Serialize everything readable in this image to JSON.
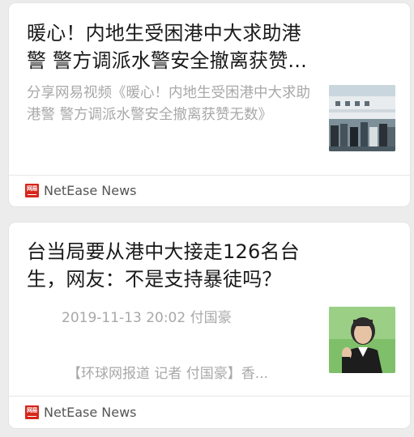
{
  "articles": [
    {
      "title_line1": "暖心！内地生受困港中大求助港",
      "title_line2": "警 警方调派水警安全撤离获赞...",
      "summary": "分享网易视频《暖心！内地生受困港中大求助港警 警方调派水警安全撤离获赞无数》",
      "thumbnail": "image-boat-rescue",
      "source_logo": "网易",
      "source_name": "NetEase News"
    },
    {
      "title_line1": "台当局要从港中大接走126名台",
      "title_line2": "生，网友：不是支持暴徒吗？",
      "meta": "2019-11-13 20:02 付国豪",
      "excerpt": "【环球网报道 记者 付国豪】香...",
      "thumbnail": "image-official-portrait",
      "source_logo": "网易",
      "source_name": "NetEase News"
    }
  ],
  "colors": {
    "background": "#ececec",
    "card": "#ffffff",
    "title": "#1a1a1a",
    "muted": "#a8a8a8",
    "brand_red": "#d6261b"
  }
}
